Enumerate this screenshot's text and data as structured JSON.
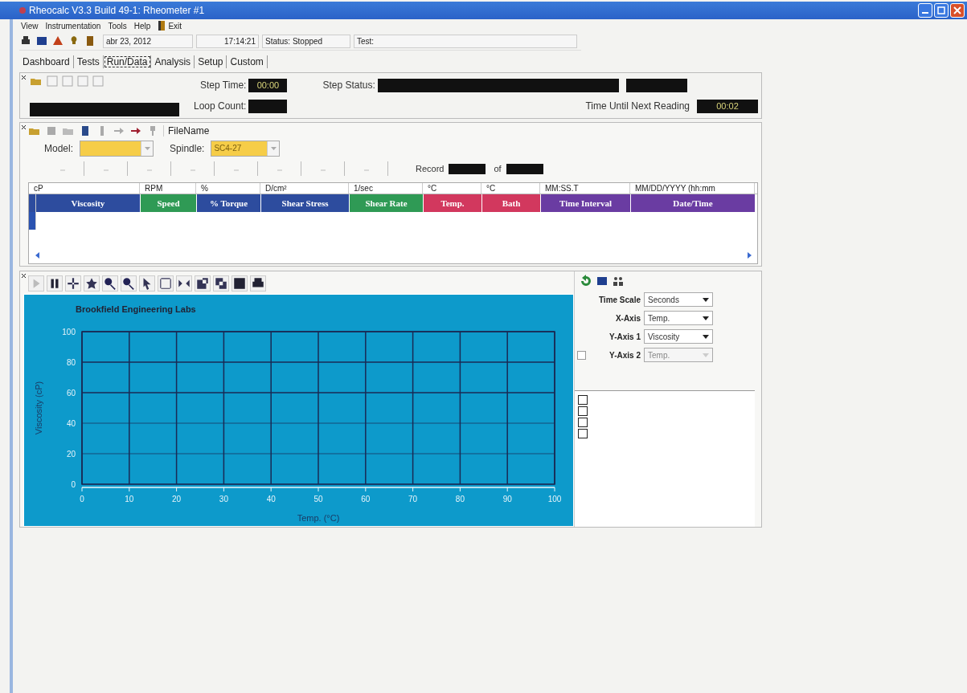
{
  "window": {
    "title": "Rheocalc V3.3 Build 49-1: Rheometer #1"
  },
  "menu": [
    {
      "label": "View",
      "kind": "text"
    },
    {
      "label": "Instrumentation",
      "kind": "text"
    },
    {
      "label": "Tools",
      "kind": "text"
    },
    {
      "label": "Help",
      "kind": "text"
    },
    {
      "label": "Exit",
      "kind": "exit"
    }
  ],
  "toolbar": {
    "date": "abr 23, 2012",
    "time": "17:14:21",
    "status": "Status: Stopped",
    "test": "Test:"
  },
  "tabs": [
    {
      "label": "Dashboard",
      "selected": false
    },
    {
      "label": "Tests",
      "selected": false
    },
    {
      "label": "Run/Data",
      "selected": true
    },
    {
      "label": "Analysis",
      "selected": false
    },
    {
      "label": "Setup",
      "selected": false
    },
    {
      "label": "Custom",
      "selected": false
    }
  ],
  "run_panel": {
    "step_time_label": "Step Time:",
    "step_time": "00:00",
    "loop_count_label": "Loop Count:",
    "step_status_label": "Step Status:",
    "next_reading_label": "Time Until Next Reading",
    "next_reading": "00:02"
  },
  "data_panel": {
    "file_name": "FileName",
    "model_label": "Model:",
    "spindle_label": "Spindle:",
    "spindle": "SC4-27",
    "spindle_disabled": true,
    "record_label": "Record",
    "of_label": "of",
    "columns": [
      {
        "unit": "cP",
        "name": "Viscosity",
        "color": "#2d4c9e"
      },
      {
        "unit": "RPM",
        "name": "Speed",
        "color": "#2f9a55"
      },
      {
        "unit": "%",
        "name": "% Torque",
        "color": "#2d4c9e"
      },
      {
        "unit": "D/cm²",
        "name": "Shear Stress",
        "color": "#2d4c9e"
      },
      {
        "unit": "1/sec",
        "name": "Shear Rate",
        "color": "#2f9a55"
      },
      {
        "unit": "°C",
        "name": "Temp.",
        "color": "#d2385e"
      },
      {
        "unit": "°C",
        "name": "Bath",
        "color": "#d2385e"
      },
      {
        "unit": "MM:SS.T",
        "name": "Time Interval",
        "color": "#6a3ca2"
      },
      {
        "unit": "MM/DD/YYYY (hh:mm",
        "name": "Date/Time",
        "color": "#6a3ca2"
      }
    ]
  },
  "chart_panel": {
    "chart_data": {
      "type": "line",
      "title": "Brookfield Engineering Labs",
      "xlabel": "Temp. (°C)",
      "ylabel": "Viscosity (cP)",
      "xlim": [
        0,
        100
      ],
      "ylim": [
        0,
        100
      ],
      "xticks": [
        0,
        10,
        20,
        30,
        40,
        50,
        60,
        70,
        80,
        90,
        100
      ],
      "yticks": [
        0,
        20,
        40,
        60,
        80,
        100
      ],
      "grid": true
    },
    "settings": [
      {
        "kind": "select",
        "label": "Time Scale",
        "value": "Seconds",
        "disabled": false
      },
      {
        "kind": "select",
        "label": "X-Axis",
        "value": "Temp.",
        "disabled": false
      },
      {
        "kind": "select",
        "label": "Y-Axis 1",
        "value": "Viscosity",
        "disabled": false
      },
      {
        "kind": "checkable",
        "label": "Y-Axis 2",
        "value": "Temp.",
        "disabled": true,
        "checked": false
      }
    ],
    "legend": [
      {
        "checked": false
      },
      {
        "checked": false
      },
      {
        "checked": false
      },
      {
        "checked": false
      }
    ]
  }
}
